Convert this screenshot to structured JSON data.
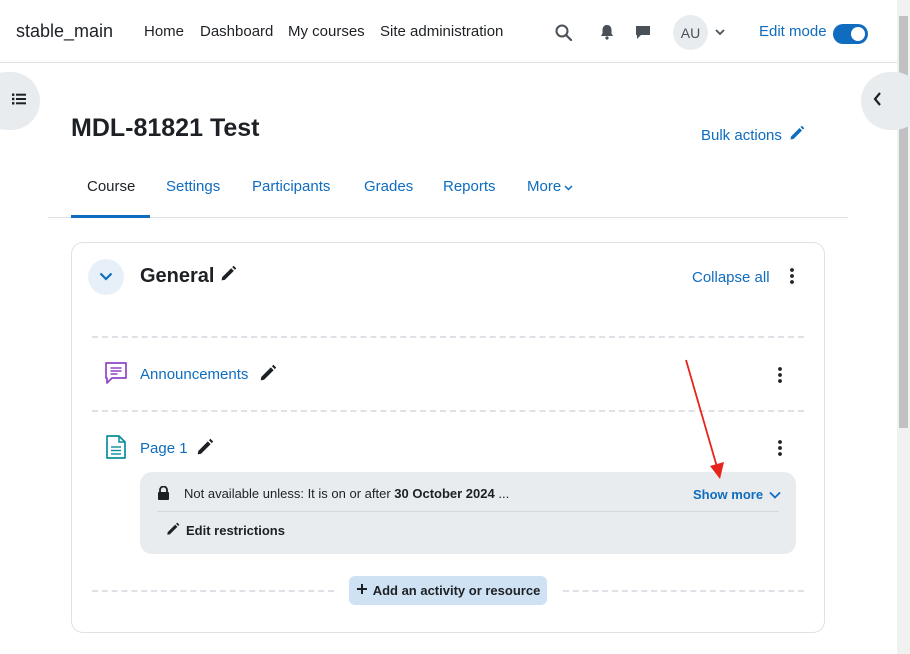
{
  "header": {
    "brand": "stable_main",
    "nav": [
      "Home",
      "Dashboard",
      "My courses",
      "Site administration"
    ],
    "avatar_initials": "AU",
    "edit_mode_label": "Edit mode",
    "edit_mode_on": true
  },
  "page": {
    "title": "MDL-81821 Test",
    "bulk_actions": "Bulk actions"
  },
  "tabs": [
    {
      "label": "Course",
      "active": true
    },
    {
      "label": "Settings"
    },
    {
      "label": "Participants"
    },
    {
      "label": "Grades"
    },
    {
      "label": "Reports"
    },
    {
      "label": "More"
    }
  ],
  "section": {
    "title": "General",
    "collapse_all": "Collapse all",
    "activities": [
      {
        "name": "Announcements",
        "icon": "forum-icon"
      },
      {
        "name": "Page 1",
        "icon": "page-icon"
      }
    ],
    "restriction": {
      "prefix": "Not available unless: It is on or after ",
      "date": "30 October 2024",
      "suffix": " ...",
      "show_more": "Show more",
      "edit_restrictions": "Edit restrictions"
    },
    "add_activity": "Add an activity or resource"
  },
  "colors": {
    "link": "#0f6cbf",
    "text": "#1d2125",
    "activity_forum": "#8f44c7",
    "activity_page": "#0c8e9b",
    "annotation_arrow": "#e8231c"
  }
}
